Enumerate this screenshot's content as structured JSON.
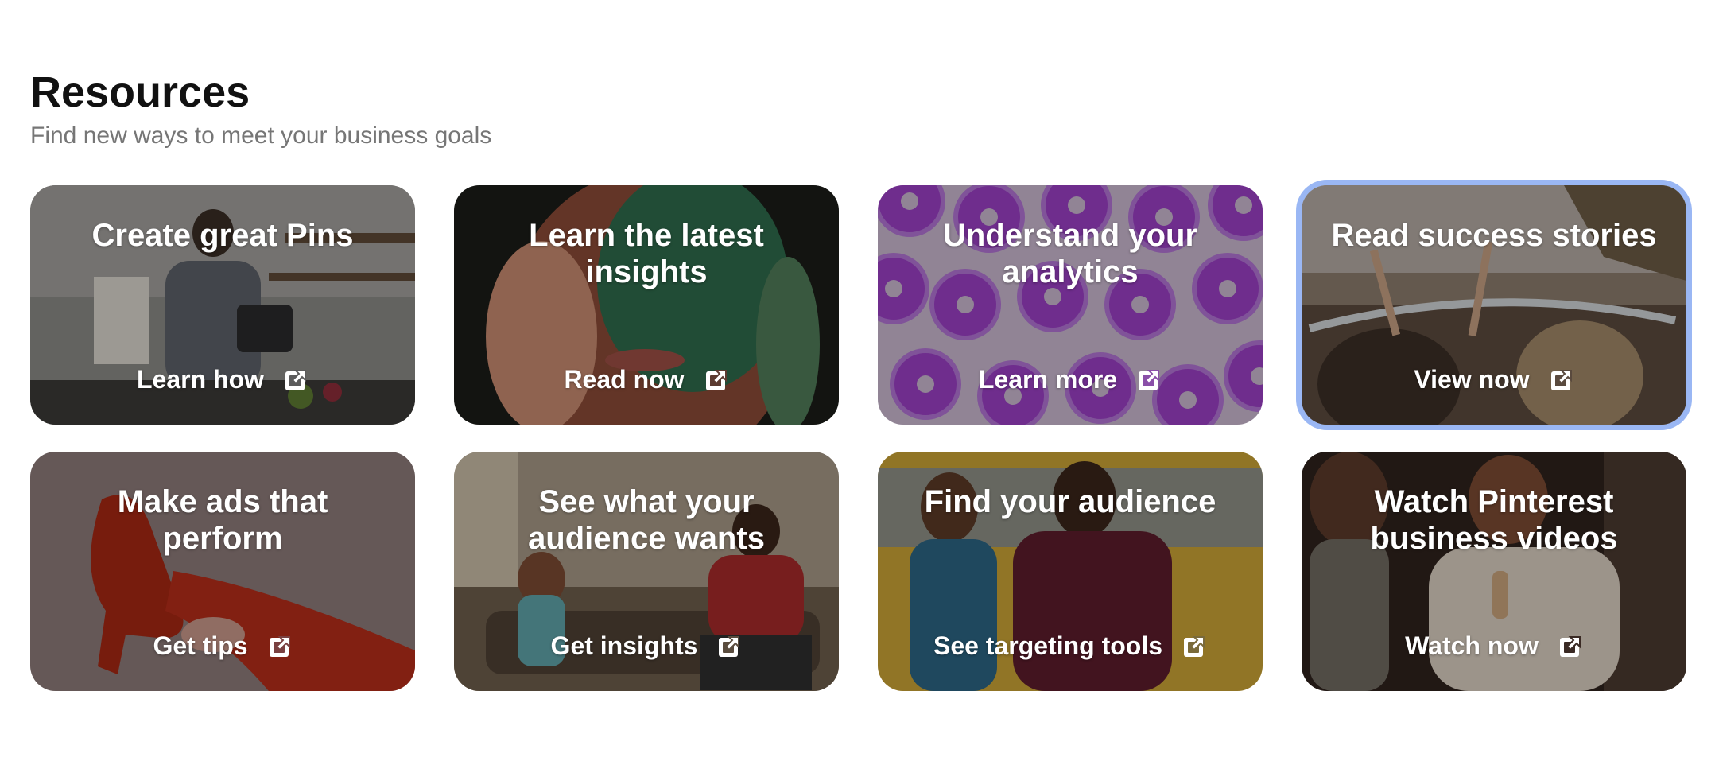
{
  "header": {
    "title": "Resources",
    "subtitle": "Find new ways to meet your business goals"
  },
  "cards": [
    {
      "title": "Create great Pins",
      "cta": "Learn how",
      "theme": "kitchen",
      "colors": [
        "#6b6a6a",
        "#9a9996",
        "#3f3b36"
      ]
    },
    {
      "title": "Learn the latest insights",
      "cta": "Read now",
      "theme": "face",
      "colors": [
        "#6a2a21",
        "#2e5f45",
        "#1a1d17"
      ]
    },
    {
      "title": "Understand your analytics",
      "cta": "Learn more",
      "theme": "donuts",
      "colors": [
        "#8a2bb8",
        "#b06ad1",
        "#c58fd8"
      ]
    },
    {
      "title": "Read success stories",
      "cta": "View now",
      "theme": "roadtrip",
      "colors": [
        "#7a6248",
        "#98a0a6",
        "#3a2f27"
      ],
      "focused": true
    },
    {
      "title": "Make ads that perform",
      "cta": "Get tips",
      "theme": "boots",
      "colors": [
        "#847070",
        "#a02612",
        "#6b5b5a"
      ]
    },
    {
      "title": "See what your audience wants",
      "cta": "Get insights",
      "theme": "livingroom",
      "colors": [
        "#8b7d6b",
        "#5a4c3e",
        "#9d2b2a"
      ]
    },
    {
      "title": "Find your audience",
      "cta": "See targeting tools",
      "theme": "bus",
      "colors": [
        "#b4922e",
        "#5a1e2a",
        "#2c5c77"
      ]
    },
    {
      "title": "Watch Pinterest business videos",
      "cta": "Watch now",
      "theme": "party",
      "colors": [
        "#3a2a24",
        "#d9cdbf",
        "#8b3a2a"
      ]
    }
  ]
}
